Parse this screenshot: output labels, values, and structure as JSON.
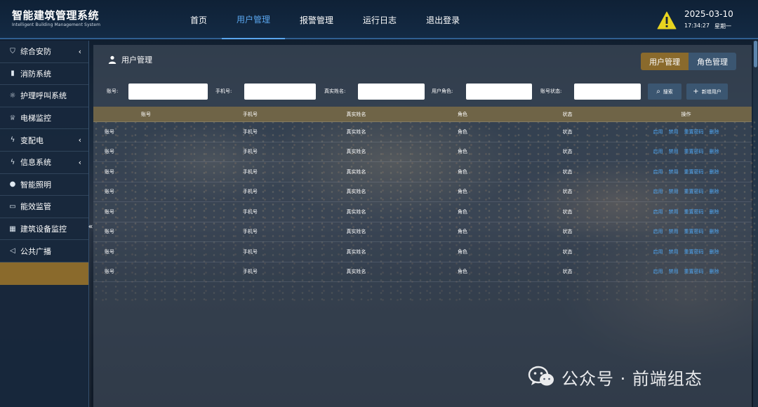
{
  "header": {
    "title": "智能建筑管理系统",
    "subtitle": "Intelligent Building Management System",
    "nav": [
      "首页",
      "用户管理",
      "报警管理",
      "运行日志",
      "退出登录"
    ],
    "active_nav": "用户管理",
    "warning_icon": "warning-triangle-icon",
    "date": "2025-03-10",
    "time": "17:34:27",
    "weekday": "星期一"
  },
  "sidebar": {
    "items": [
      {
        "label": "综合安防",
        "icon": "shield-icon",
        "has_submenu": true
      },
      {
        "label": "消防系统",
        "icon": "fire-extinguisher-icon",
        "has_submenu": false
      },
      {
        "label": "护理呼叫系统",
        "icon": "nurse-call-icon",
        "has_submenu": false
      },
      {
        "label": "电梯监控",
        "icon": "elevator-icon",
        "has_submenu": false
      },
      {
        "label": "变配电",
        "icon": "lightning-icon",
        "has_submenu": true
      },
      {
        "label": "信息系统",
        "icon": "lightning-icon",
        "has_submenu": true
      },
      {
        "label": "智能照明",
        "icon": "bulb-icon",
        "has_submenu": false
      },
      {
        "label": "能效监管",
        "icon": "meter-icon",
        "has_submenu": false
      },
      {
        "label": "建筑设备监控",
        "icon": "building-icon",
        "has_submenu": false
      },
      {
        "label": "公共广播",
        "icon": "speaker-icon",
        "has_submenu": false
      },
      {
        "label": "",
        "icon": "",
        "has_submenu": false,
        "active": true
      }
    ],
    "collapse_icon": "chevron-left-icon"
  },
  "main": {
    "title": "用户管理",
    "title_icon": "user-icon",
    "tabs": [
      {
        "label": "用户管理",
        "active": true
      },
      {
        "label": "角色管理",
        "active": false
      }
    ],
    "search": {
      "fields": [
        {
          "label": "账号:",
          "value": "",
          "placeholder": ""
        },
        {
          "label": "手机号:",
          "value": "",
          "placeholder": ""
        },
        {
          "label": "真实姓名:",
          "value": "",
          "placeholder": ""
        },
        {
          "label": "用户角色:",
          "value": "",
          "placeholder": ""
        },
        {
          "label": "账号状态:",
          "value": "",
          "placeholder": ""
        }
      ],
      "search_button": "搜索",
      "add_button": "新增用户"
    },
    "table": {
      "headers": [
        "账号",
        "手机号",
        "真实姓名",
        "角色",
        "状态",
        "操作"
      ],
      "rows": [
        {
          "account": "账号",
          "phone": "手机号",
          "name": "真实姓名",
          "role": "角色",
          "status": "状态"
        },
        {
          "account": "账号",
          "phone": "手机号",
          "name": "真实姓名",
          "role": "角色",
          "status": "状态"
        },
        {
          "account": "账号",
          "phone": "手机号",
          "name": "真实姓名",
          "role": "角色",
          "status": "状态"
        },
        {
          "account": "账号",
          "phone": "手机号",
          "name": "真实姓名",
          "role": "角色",
          "status": "状态"
        },
        {
          "account": "账号",
          "phone": "手机号",
          "name": "真实姓名",
          "role": "角色",
          "status": "状态"
        },
        {
          "account": "账号",
          "phone": "手机号",
          "name": "真实姓名",
          "role": "角色",
          "status": "状态"
        },
        {
          "account": "账号",
          "phone": "手机号",
          "name": "真实姓名",
          "role": "角色",
          "status": "状态"
        },
        {
          "account": "账号",
          "phone": "手机号",
          "name": "真实姓名",
          "role": "角色",
          "status": "状态"
        }
      ],
      "row_actions": [
        "启用",
        "禁用",
        "重置密码",
        "删除"
      ]
    }
  },
  "watermark": {
    "text": "公众号 · 前端组态",
    "icon": "wechat-icon"
  },
  "colors": {
    "header_bg": "#132a44",
    "accent_blue": "#5aa6ee",
    "gold": "#8a6a2c",
    "table_header": "#6f6447",
    "link": "#4fa6f2",
    "button": "#3b5671"
  }
}
